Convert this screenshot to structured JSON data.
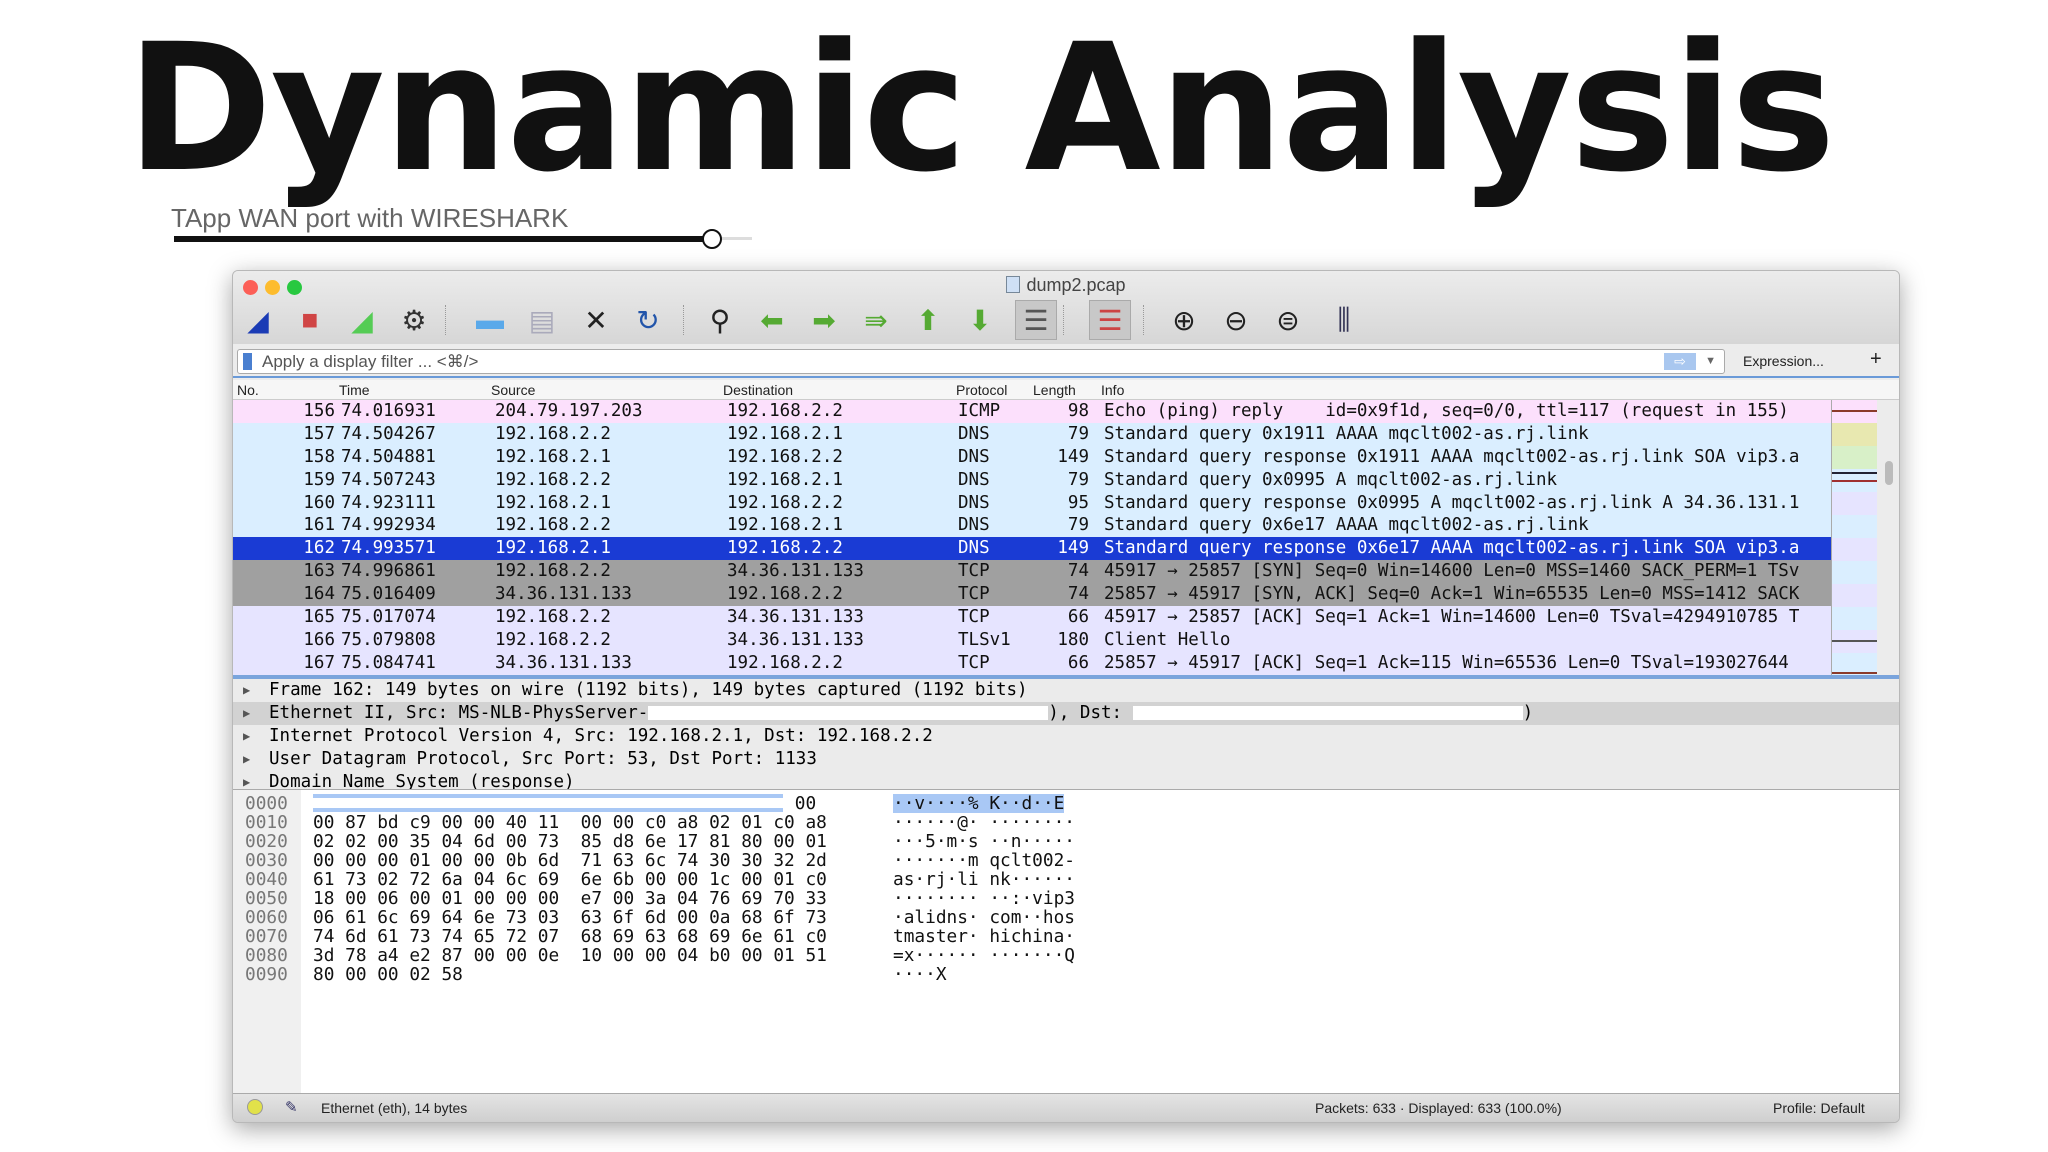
{
  "slide": {
    "title": "Dynamic Analysis",
    "subtitle": "TApp WAN port with WIRESHARK",
    "slider_progress": 0.93
  },
  "window": {
    "title": "dump2.pcap"
  },
  "toolbar": {
    "icons": [
      "shark-fin-start-icon",
      "stop-capture-icon",
      "restart-capture-icon",
      "capture-options-gear-icon",
      "open-folder-icon",
      "save-file-icon",
      "close-file-icon",
      "reload-file-icon",
      "find-packet-icon",
      "go-back-icon",
      "go-forward-icon",
      "go-to-packet-icon",
      "first-packet-icon",
      "last-packet-icon",
      "autoscroll-icon",
      "colorize-icon",
      "zoom-in-icon",
      "zoom-out-icon",
      "normal-size-icon",
      "resize-columns-icon"
    ]
  },
  "filter": {
    "placeholder": "Apply a display filter ... <⌘/>",
    "expression_label": "Expression...",
    "add_label": "+",
    "apply_icon": "⇨"
  },
  "columns": {
    "no": "No.",
    "time": "Time",
    "source": "Source",
    "destination": "Destination",
    "protocol": "Protocol",
    "length": "Length",
    "info": "Info"
  },
  "packets": [
    {
      "no": "156",
      "time": "74.016931",
      "src": "204.79.197.203",
      "dst": "192.168.2.2",
      "proto": "ICMP",
      "len": "98",
      "info": "Echo (ping) reply    id=0x9f1d, seq=0/0, ttl=117 (request in 155)",
      "color": "#fce0fc"
    },
    {
      "no": "157",
      "time": "74.504267",
      "src": "192.168.2.2",
      "dst": "192.168.2.1",
      "proto": "DNS",
      "len": "79",
      "info": "Standard query 0x1911 AAAA mqclt002-as.rj.link",
      "color": "#daeeff"
    },
    {
      "no": "158",
      "time": "74.504881",
      "src": "192.168.2.1",
      "dst": "192.168.2.2",
      "proto": "DNS",
      "len": "149",
      "info": "Standard query response 0x1911 AAAA mqclt002-as.rj.link SOA vip3.a",
      "color": "#daeeff"
    },
    {
      "no": "159",
      "time": "74.507243",
      "src": "192.168.2.2",
      "dst": "192.168.2.1",
      "proto": "DNS",
      "len": "79",
      "info": "Standard query 0x0995 A mqclt002-as.rj.link",
      "color": "#daeeff"
    },
    {
      "no": "160",
      "time": "74.923111",
      "src": "192.168.2.1",
      "dst": "192.168.2.2",
      "proto": "DNS",
      "len": "95",
      "info": "Standard query response 0x0995 A mqclt002-as.rj.link A 34.36.131.1",
      "color": "#daeeff"
    },
    {
      "no": "161",
      "time": "74.992934",
      "src": "192.168.2.2",
      "dst": "192.168.2.1",
      "proto": "DNS",
      "len": "79",
      "info": "Standard query 0x6e17 AAAA mqclt002-as.rj.link",
      "color": "#daeeff"
    },
    {
      "no": "162",
      "time": "74.993571",
      "src": "192.168.2.1",
      "dst": "192.168.2.2",
      "proto": "DNS",
      "len": "149",
      "info": "Standard query response 0x6e17 AAAA mqclt002-as.rj.link SOA vip3.a",
      "color": "#1a3bd4",
      "selected": true
    },
    {
      "no": "163",
      "time": "74.996861",
      "src": "192.168.2.2",
      "dst": "34.36.131.133",
      "proto": "TCP",
      "len": "74",
      "info": "45917 → 25857 [SYN] Seq=0 Win=14600 Len=0 MSS=1460 SACK_PERM=1 TSv",
      "color": "#a0a0a0"
    },
    {
      "no": "164",
      "time": "75.016409",
      "src": "34.36.131.133",
      "dst": "192.168.2.2",
      "proto": "TCP",
      "len": "74",
      "info": "25857 → 45917 [SYN, ACK] Seq=0 Ack=1 Win=65535 Len=0 MSS=1412 SACK",
      "color": "#a0a0a0"
    },
    {
      "no": "165",
      "time": "75.017074",
      "src": "192.168.2.2",
      "dst": "34.36.131.133",
      "proto": "TCP",
      "len": "66",
      "info": "45917 → 25857 [ACK] Seq=1 Ack=1 Win=14600 Len=0 TSval=4294910785 T",
      "color": "#e6e4ff"
    },
    {
      "no": "166",
      "time": "75.079808",
      "src": "192.168.2.2",
      "dst": "34.36.131.133",
      "proto": "TLSv1",
      "len": "180",
      "info": "Client Hello",
      "color": "#e6e4ff"
    },
    {
      "no": "167",
      "time": "75.084741",
      "src": "34.36.131.133",
      "dst": "192.168.2.2",
      "proto": "TCP",
      "len": "66",
      "info": "25857 → 45917 [ACK] Seq=1 Ack=115 Win=65536 Len=0 TSval=193027644",
      "color": "#e6e4ff"
    }
  ],
  "details": [
    "Frame 162: 149 bytes on wire (1192 bits), 149 bytes captured (1192 bits)",
    "Ethernet II, Src: MS-NLB-PhysServer-",
    "Internet Protocol Version 4, Src: 192.168.2.1, Dst: 192.168.2.2",
    "User Datagram Protocol, Src Port: 53, Dst Port: 1133",
    "Domain Name System (response)"
  ],
  "details_eth_mid": "), Dst: ",
  "details_eth_end": ")",
  "hex": [
    {
      "off": "0000",
      "hex": "                                             00",
      "ascii": "··v····% K··d··E"
    },
    {
      "off": "0010",
      "hex": "00 87 bd c9 00 00 40 11  00 00 c0 a8 02 01 c0 a8",
      "ascii": "······@· ········"
    },
    {
      "off": "0020",
      "hex": "02 02 00 35 04 6d 00 73  85 d8 6e 17 81 80 00 01",
      "ascii": "···5·m·s ··n·····"
    },
    {
      "off": "0030",
      "hex": "00 00 00 01 00 00 0b 6d  71 63 6c 74 30 30 32 2d",
      "ascii": "·······m qclt002-"
    },
    {
      "off": "0040",
      "hex": "61 73 02 72 6a 04 6c 69  6e 6b 00 00 1c 00 01 c0",
      "ascii": "as·rj·li nk······"
    },
    {
      "off": "0050",
      "hex": "18 00 06 00 01 00 00 00  e7 00 3a 04 76 69 70 33",
      "ascii": "········ ··:·vip3"
    },
    {
      "off": "0060",
      "hex": "06 61 6c 69 64 6e 73 03  63 6f 6d 00 0a 68 6f 73",
      "ascii": "·alidns· com··hos"
    },
    {
      "off": "0070",
      "hex": "74 6d 61 73 74 65 72 07  68 69 63 68 69 6e 61 c0",
      "ascii": "tmaster· hichina·"
    },
    {
      "off": "0080",
      "hex": "3d 78 a4 e2 87 00 00 0e  10 00 00 04 b0 00 01 51",
      "ascii": "=x······ ·······Q"
    },
    {
      "off": "0090",
      "hex": "80 00 00 02 58",
      "ascii": "····X"
    }
  ],
  "status": {
    "left": "Ethernet (eth), 14 bytes",
    "packets": "Packets: 633 · Displayed: 633 (100.0%)",
    "profile": "Profile: Default"
  }
}
